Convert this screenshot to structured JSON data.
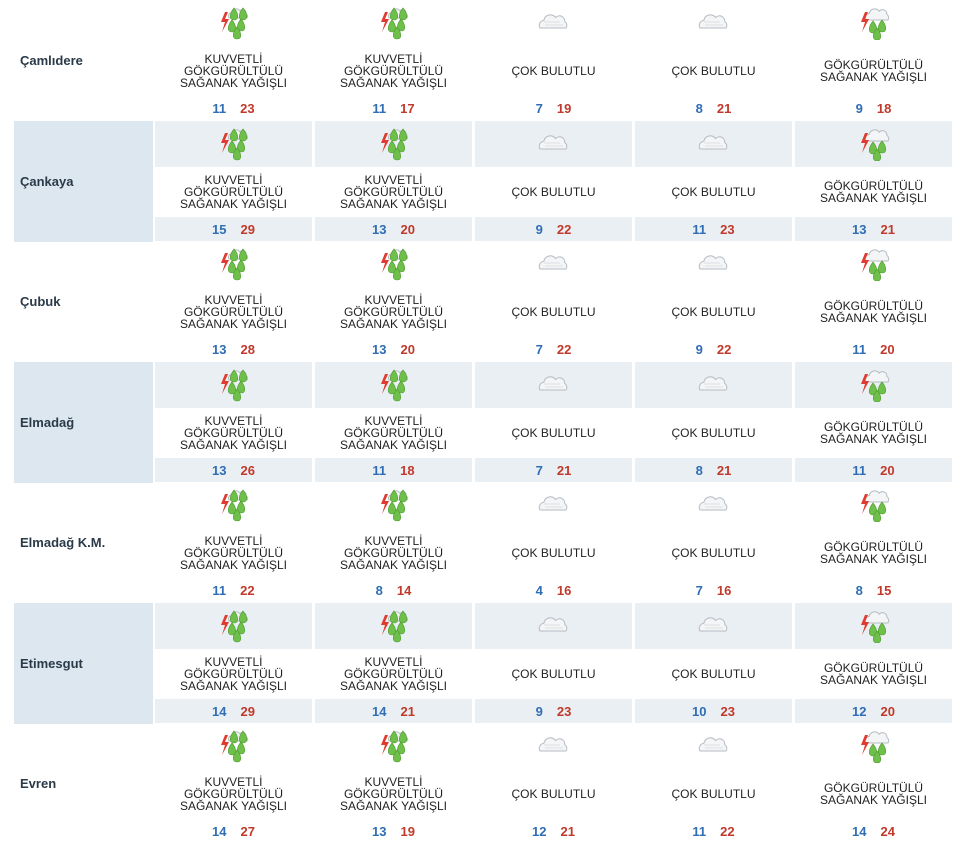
{
  "colors": {
    "min_temp": "#2f6db5",
    "max_temp": "#c0392b",
    "row_shade": "#eaeff3",
    "name_shade": "#dde7ef"
  },
  "icons": {
    "storm_heavy": "storm-heavy-rain-icon",
    "cloud": "cloudy-icon",
    "storm": "thunderstorm-rain-icon"
  },
  "labels": {
    "heavy_storm": "KUVVETLİ\nGÖKGÜRÜLTÜLÜ\nSAĞANAK YAĞIŞLI",
    "cloudy": "ÇOK BULUTLU",
    "storm": "GÖKGÜRÜLTÜLÜ\nSAĞANAK YAĞIŞLI"
  },
  "locations": [
    {
      "name": "Çamlıdere",
      "days": [
        {
          "icon": "storm_heavy",
          "condition": "KUVVETLİ\nGÖKGÜRÜLTÜLÜ\nSAĞANAK YAĞIŞLI",
          "min": "11",
          "max": "23"
        },
        {
          "icon": "storm_heavy",
          "condition": "KUVVETLİ\nGÖKGÜRÜLTÜLÜ\nSAĞANAK YAĞIŞLI",
          "min": "11",
          "max": "17"
        },
        {
          "icon": "cloud",
          "condition": "ÇOK BULUTLU",
          "min": "7",
          "max": "19"
        },
        {
          "icon": "cloud",
          "condition": "ÇOK BULUTLU",
          "min": "8",
          "max": "21"
        },
        {
          "icon": "storm",
          "condition": "GÖKGÜRÜLTÜLÜ\nSAĞANAK YAĞIŞLI",
          "min": "9",
          "max": "18"
        }
      ]
    },
    {
      "name": "Çankaya",
      "days": [
        {
          "icon": "storm_heavy",
          "condition": "KUVVETLİ\nGÖKGÜRÜLTÜLÜ\nSAĞANAK YAĞIŞLI",
          "min": "15",
          "max": "29"
        },
        {
          "icon": "storm_heavy",
          "condition": "KUVVETLİ\nGÖKGÜRÜLTÜLÜ\nSAĞANAK YAĞIŞLI",
          "min": "13",
          "max": "20"
        },
        {
          "icon": "cloud",
          "condition": "ÇOK BULUTLU",
          "min": "9",
          "max": "22"
        },
        {
          "icon": "cloud",
          "condition": "ÇOK BULUTLU",
          "min": "11",
          "max": "23"
        },
        {
          "icon": "storm",
          "condition": "GÖKGÜRÜLTÜLÜ\nSAĞANAK YAĞIŞLI",
          "min": "13",
          "max": "21"
        }
      ]
    },
    {
      "name": "Çubuk",
      "days": [
        {
          "icon": "storm_heavy",
          "condition": "KUVVETLİ\nGÖKGÜRÜLTÜLÜ\nSAĞANAK YAĞIŞLI",
          "min": "13",
          "max": "28"
        },
        {
          "icon": "storm_heavy",
          "condition": "KUVVETLİ\nGÖKGÜRÜLTÜLÜ\nSAĞANAK YAĞIŞLI",
          "min": "13",
          "max": "20"
        },
        {
          "icon": "cloud",
          "condition": "ÇOK BULUTLU",
          "min": "7",
          "max": "22"
        },
        {
          "icon": "cloud",
          "condition": "ÇOK BULUTLU",
          "min": "9",
          "max": "22"
        },
        {
          "icon": "storm",
          "condition": "GÖKGÜRÜLTÜLÜ\nSAĞANAK YAĞIŞLI",
          "min": "11",
          "max": "20"
        }
      ]
    },
    {
      "name": "Elmadağ",
      "days": [
        {
          "icon": "storm_heavy",
          "condition": "KUVVETLİ\nGÖKGÜRÜLTÜLÜ\nSAĞANAK YAĞIŞLI",
          "min": "13",
          "max": "26"
        },
        {
          "icon": "storm_heavy",
          "condition": "KUVVETLİ\nGÖKGÜRÜLTÜLÜ\nSAĞANAK YAĞIŞLI",
          "min": "11",
          "max": "18"
        },
        {
          "icon": "cloud",
          "condition": "ÇOK BULUTLU",
          "min": "7",
          "max": "21"
        },
        {
          "icon": "cloud",
          "condition": "ÇOK BULUTLU",
          "min": "8",
          "max": "21"
        },
        {
          "icon": "storm",
          "condition": "GÖKGÜRÜLTÜLÜ\nSAĞANAK YAĞIŞLI",
          "min": "11",
          "max": "20"
        }
      ]
    },
    {
      "name": "Elmadağ K.M.",
      "days": [
        {
          "icon": "storm_heavy",
          "condition": "KUVVETLİ\nGÖKGÜRÜLTÜLÜ\nSAĞANAK YAĞIŞLI",
          "min": "11",
          "max": "22"
        },
        {
          "icon": "storm_heavy",
          "condition": "KUVVETLİ\nGÖKGÜRÜLTÜLÜ\nSAĞANAK YAĞIŞLI",
          "min": "8",
          "max": "14"
        },
        {
          "icon": "cloud",
          "condition": "ÇOK BULUTLU",
          "min": "4",
          "max": "16"
        },
        {
          "icon": "cloud",
          "condition": "ÇOK BULUTLU",
          "min": "7",
          "max": "16"
        },
        {
          "icon": "storm",
          "condition": "GÖKGÜRÜLTÜLÜ\nSAĞANAK YAĞIŞLI",
          "min": "8",
          "max": "15"
        }
      ]
    },
    {
      "name": "Etimesgut",
      "days": [
        {
          "icon": "storm_heavy",
          "condition": "KUVVETLİ\nGÖKGÜRÜLTÜLÜ\nSAĞANAK YAĞIŞLI",
          "min": "14",
          "max": "29"
        },
        {
          "icon": "storm_heavy",
          "condition": "KUVVETLİ\nGÖKGÜRÜLTÜLÜ\nSAĞANAK YAĞIŞLI",
          "min": "14",
          "max": "21"
        },
        {
          "icon": "cloud",
          "condition": "ÇOK BULUTLU",
          "min": "9",
          "max": "23"
        },
        {
          "icon": "cloud",
          "condition": "ÇOK BULUTLU",
          "min": "10",
          "max": "23"
        },
        {
          "icon": "storm",
          "condition": "GÖKGÜRÜLTÜLÜ\nSAĞANAK YAĞIŞLI",
          "min": "12",
          "max": "20"
        }
      ]
    },
    {
      "name": "Evren",
      "days": [
        {
          "icon": "storm_heavy",
          "condition": "KUVVETLİ\nGÖKGÜRÜLTÜLÜ\nSAĞANAK YAĞIŞLI",
          "min": "14",
          "max": "27"
        },
        {
          "icon": "storm_heavy",
          "condition": "KUVVETLİ\nGÖKGÜRÜLTÜLÜ\nSAĞANAK YAĞIŞLI",
          "min": "13",
          "max": "19"
        },
        {
          "icon": "cloud",
          "condition": "ÇOK BULUTLU",
          "min": "12",
          "max": "21"
        },
        {
          "icon": "cloud",
          "condition": "ÇOK BULUTLU",
          "min": "11",
          "max": "22"
        },
        {
          "icon": "storm",
          "condition": "GÖKGÜRÜLTÜLÜ\nSAĞANAK YAĞIŞLI",
          "min": "14",
          "max": "24"
        }
      ]
    }
  ]
}
